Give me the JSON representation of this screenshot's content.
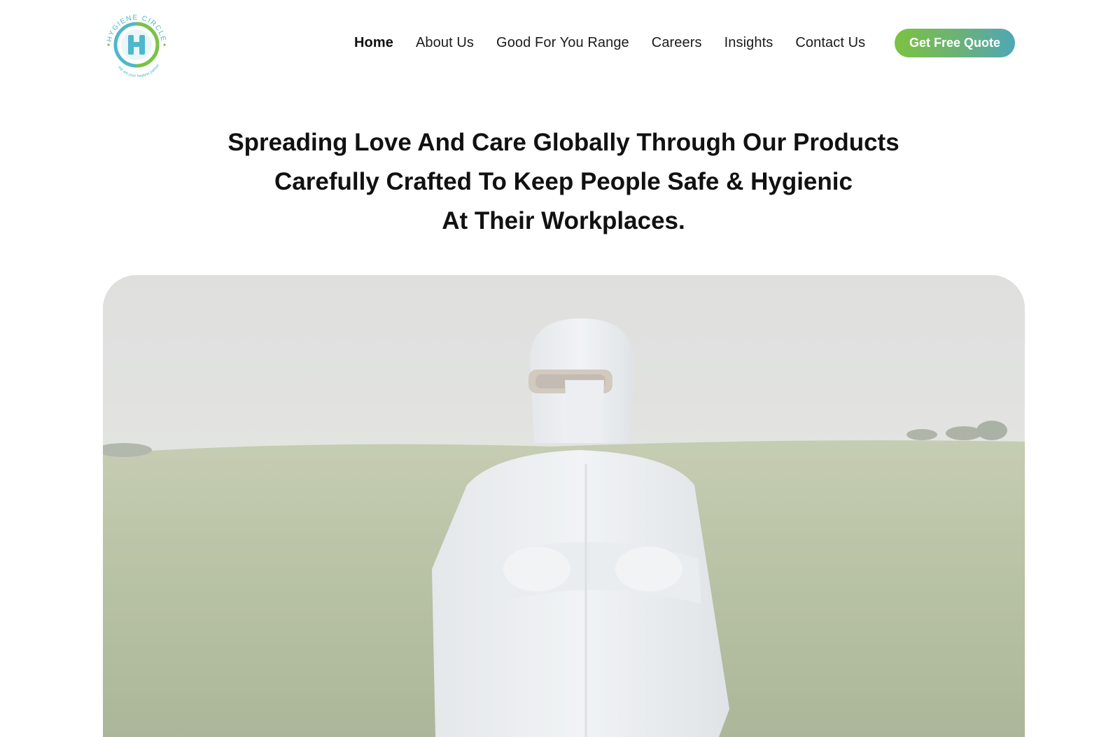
{
  "header": {
    "logo": {
      "name": "HYGIENE CIRCLE",
      "tagline": "We are your hygiene partner",
      "letter": "H"
    },
    "nav": [
      {
        "label": "Home",
        "active": true
      },
      {
        "label": "About Us",
        "active": false
      },
      {
        "label": "Good For You Range",
        "active": false
      },
      {
        "label": "Careers",
        "active": false
      },
      {
        "label": "Insights",
        "active": false
      },
      {
        "label": "Contact Us",
        "active": false
      }
    ],
    "cta_label": "Get Free Quote"
  },
  "hero": {
    "headline_lines": [
      "Spreading Love And Care Globally Through Our Products",
      "Carefully Crafted To Keep People Safe & Hygienic",
      "At Their Workplaces."
    ]
  },
  "colors": {
    "brand_teal": "#4fb7cb",
    "brand_green": "#7cc242",
    "text": "#111111"
  }
}
